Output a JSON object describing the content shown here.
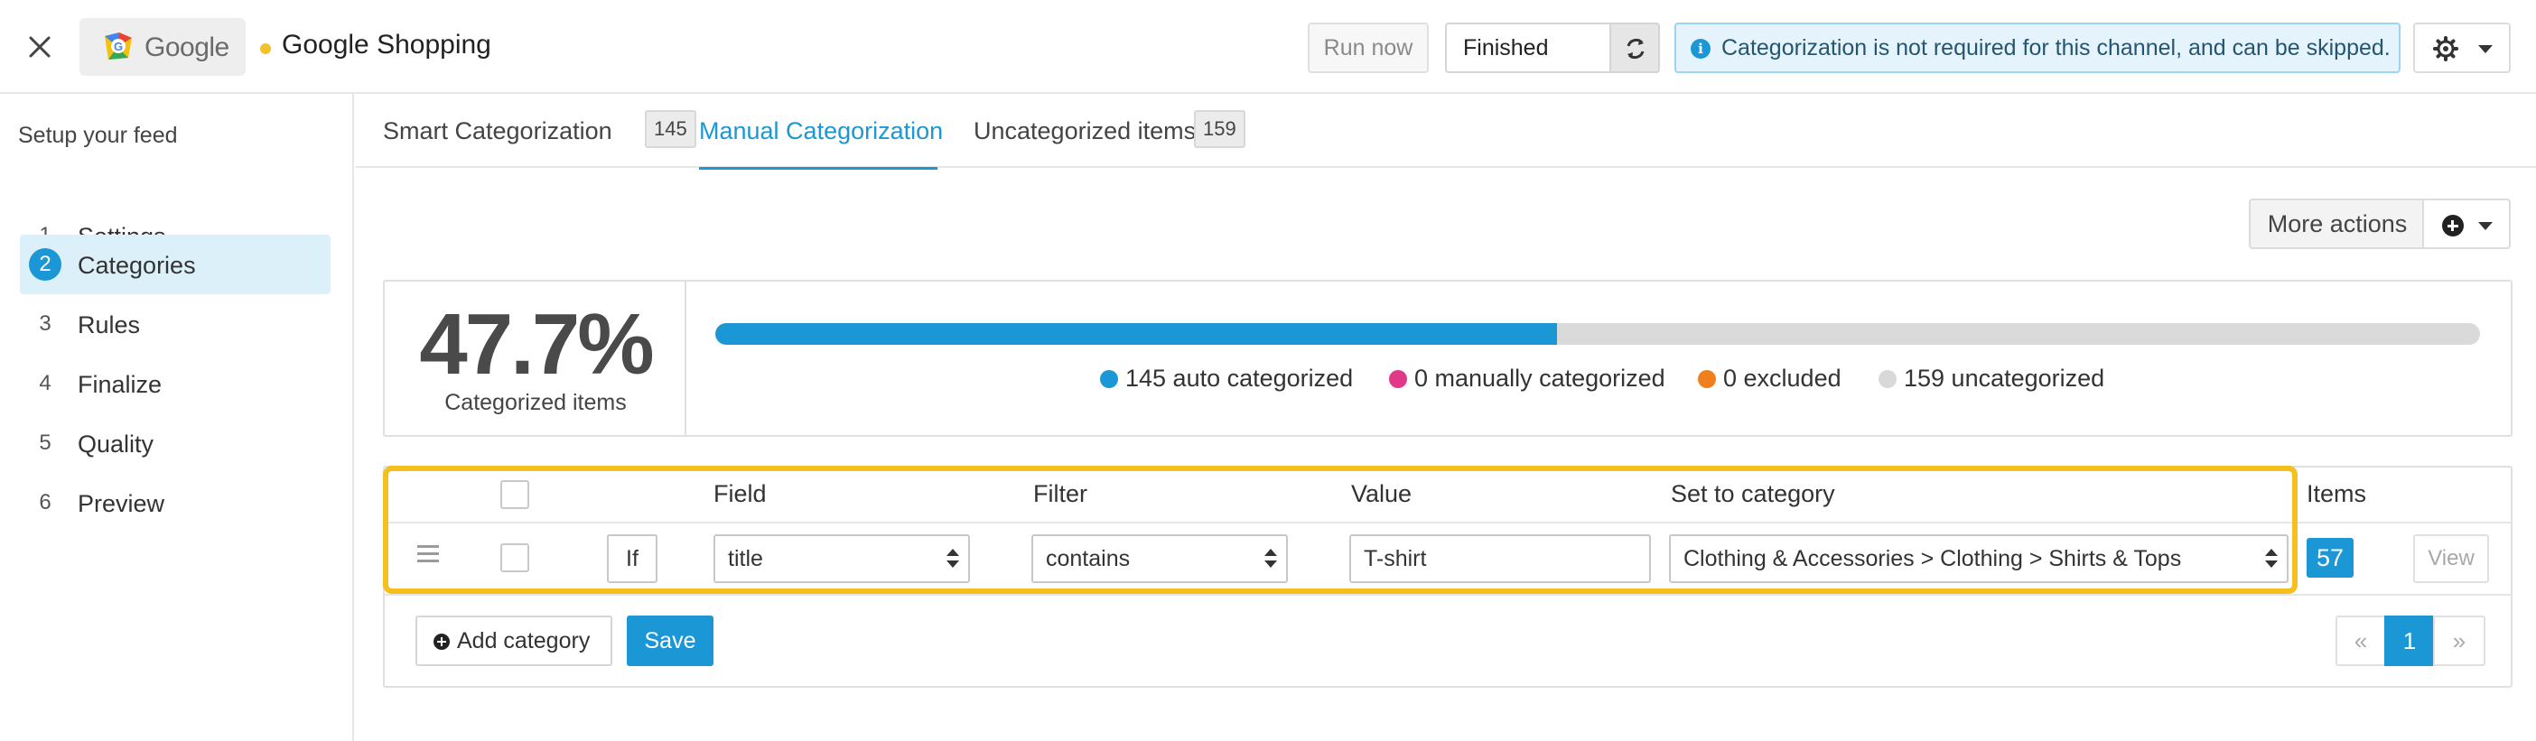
{
  "header": {
    "logo_text": "Google",
    "channel_title": "Google Shopping",
    "run_now_label": "Run now",
    "status_value": "Finished",
    "info_message": "Categorization is not required for this channel, and can be skipped.",
    "icons": [
      "close-icon",
      "refresh-icon",
      "info-icon",
      "gear-icon",
      "chevron-down-icon"
    ]
  },
  "sidebar": {
    "heading": "Setup your feed",
    "steps": [
      {
        "num": "1",
        "label": "Settings"
      },
      {
        "num": "2",
        "label": "Categories",
        "active": true
      },
      {
        "num": "3",
        "label": "Rules"
      },
      {
        "num": "4",
        "label": "Finalize"
      },
      {
        "num": "5",
        "label": "Quality"
      },
      {
        "num": "6",
        "label": "Preview"
      }
    ]
  },
  "tabs": [
    {
      "label": "Smart Categorization",
      "count": "145"
    },
    {
      "label": "Manual Categorization",
      "active": true
    },
    {
      "label": "Uncategorized items",
      "count": "159"
    }
  ],
  "more_actions_label": "More actions",
  "stats": {
    "percent": "47.7%",
    "percent_label": "Categorized items",
    "progress_fraction": 0.477,
    "legend": [
      {
        "label": "145 auto categorized",
        "color": "#1c97d5"
      },
      {
        "label": "0 manually categorized",
        "color": "#e0398a"
      },
      {
        "label": "0 excluded",
        "color": "#f07f1e"
      },
      {
        "label": "159 uncategorized",
        "color": "#d9d9d9"
      }
    ]
  },
  "rules_table": {
    "headers": {
      "field": "Field",
      "filter": "Filter",
      "value": "Value",
      "category": "Set to category",
      "items": "Items"
    },
    "row": {
      "if_label": "If",
      "field": "title",
      "filter": "contains",
      "value": "T-shirt",
      "category": "Clothing & Accessories > Clothing > Shirts & Tops",
      "items": "57",
      "view_label": "View"
    },
    "add_category_label": "Add category",
    "save_label": "Save",
    "pagination": {
      "prev": "«",
      "current": "1",
      "next": "»"
    }
  },
  "colors": {
    "accent": "#1c97d5",
    "highlight": "#f5bf1f",
    "status_dot": "#f2c12e"
  }
}
